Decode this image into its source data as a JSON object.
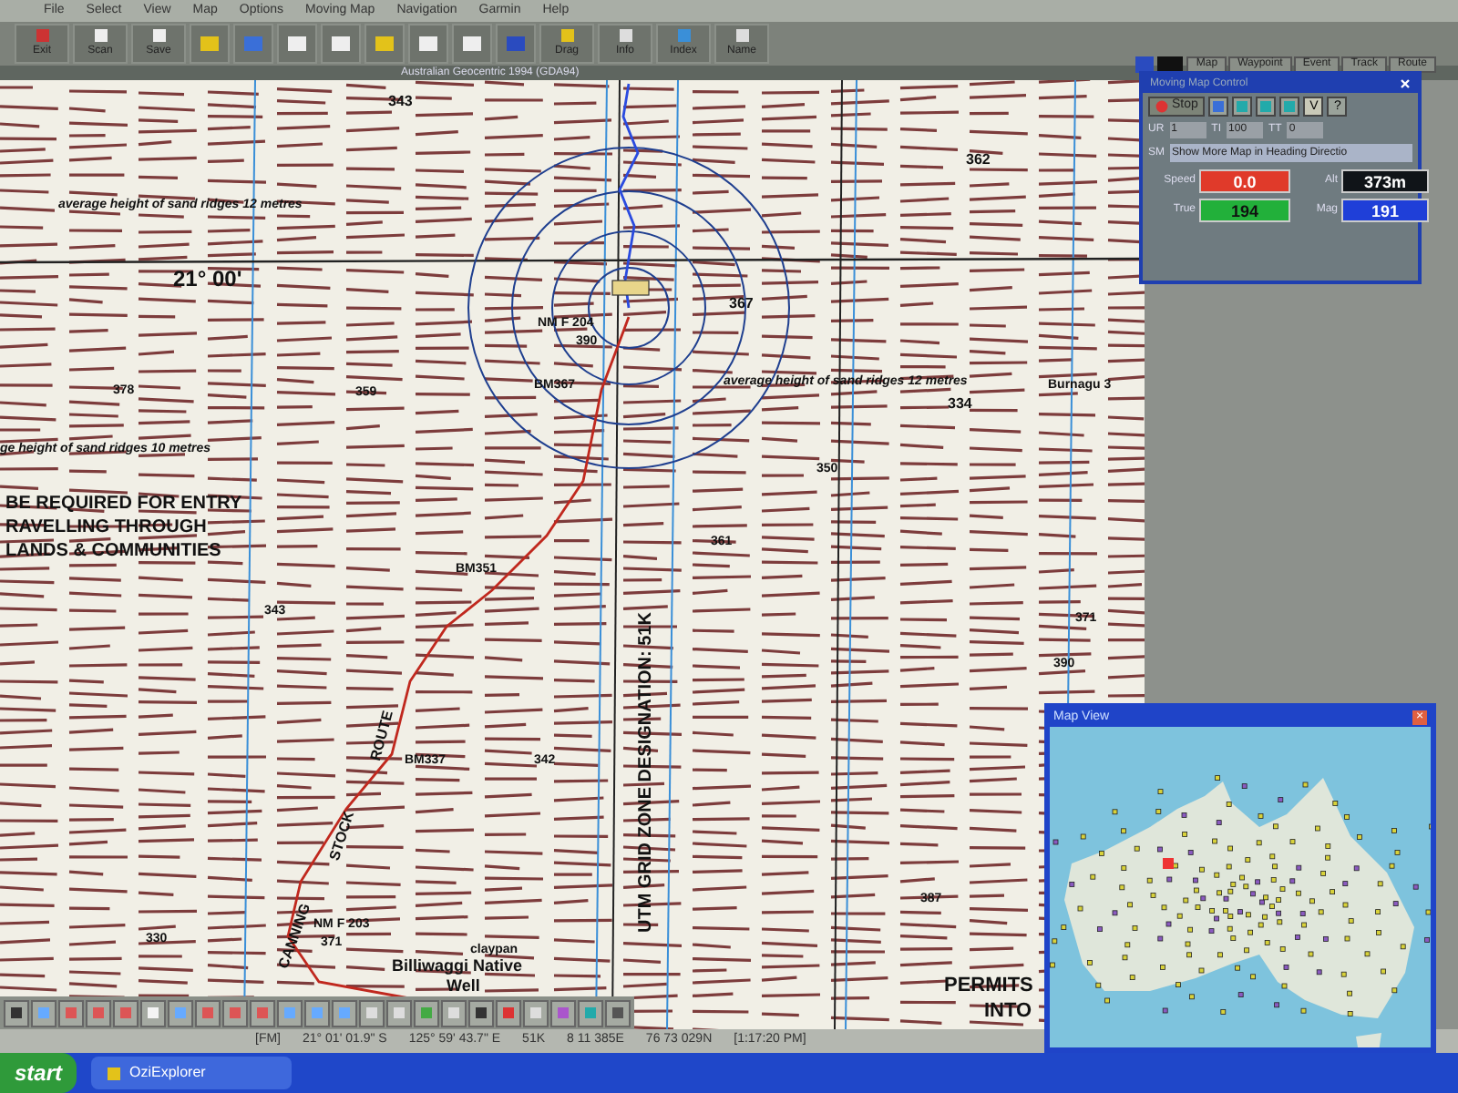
{
  "menu": [
    "File",
    "Select",
    "View",
    "Map",
    "Options",
    "Moving Map",
    "Navigation",
    "Garmin",
    "Help"
  ],
  "toolbar": [
    {
      "label": "Exit"
    },
    {
      "label": "Scan"
    },
    {
      "label": "Save"
    },
    {
      "label": "Drag"
    },
    {
      "label": "Info"
    },
    {
      "label": "Index"
    },
    {
      "label": "Name"
    }
  ],
  "datum": "Australian Geocentric 1994 (GDA94)",
  "view_tabs": [
    {
      "label": "Map"
    },
    {
      "label": "Waypoint"
    },
    {
      "label": "Event"
    },
    {
      "label": "Track"
    },
    {
      "label": "Route"
    }
  ],
  "map_labels": [
    "343",
    "362",
    "average height of sand ridges 12 metres",
    "21° 00'",
    "367",
    "NM F 204",
    "390",
    "378",
    "359",
    "BM367",
    "average height of sand ridges 12 metres",
    "334",
    "Burnagu 3",
    "ge height of sand ridges 10 metres",
    "350",
    "BE REQUIRED FOR ENTRY",
    "RAVELLING THROUGH",
    "LANDS & COMMUNITIES",
    "361",
    "BM351",
    "343",
    "371",
    "UTM GRID ZONE DESIGNATION: 51K",
    "390",
    "CANNING",
    "STOCK",
    "ROUTE",
    "BM337",
    "342",
    "387",
    "330",
    "NM F 203",
    "371",
    "claypan",
    "Billiwaggi Native",
    "Well",
    "PERMITS",
    "INTO"
  ],
  "moving_map": {
    "title": "Moving Map Control",
    "stop": "Stop",
    "v": "V",
    "help": "?",
    "fields": [
      {
        "label": "UR",
        "value": "1"
      },
      {
        "label": "TI",
        "value": "100"
      },
      {
        "label": "TT",
        "value": "0"
      }
    ],
    "sm": {
      "label": "SM",
      "value": "Show More Map in Heading Directio"
    },
    "readouts": [
      {
        "label": "Speed",
        "value": "0.0",
        "color": "#e03a2a"
      },
      {
        "label": "Alt",
        "value": "373m",
        "color": "#101418"
      },
      {
        "label": "True",
        "value": "194",
        "color": "#22b03a"
      },
      {
        "label": "Mag",
        "value": "191",
        "color": "#1f3fd8"
      }
    ]
  },
  "map_view": {
    "title": "Map View",
    "close": "×"
  },
  "status": [
    "[FM]",
    "21° 01' 01.9\" S",
    "125° 59' 43.7\" E",
    "51K",
    "8 11 385E",
    "76 73 029N",
    "[1:17:20 PM]"
  ],
  "taskbar": {
    "start": "start",
    "app": "OziExplorer"
  }
}
